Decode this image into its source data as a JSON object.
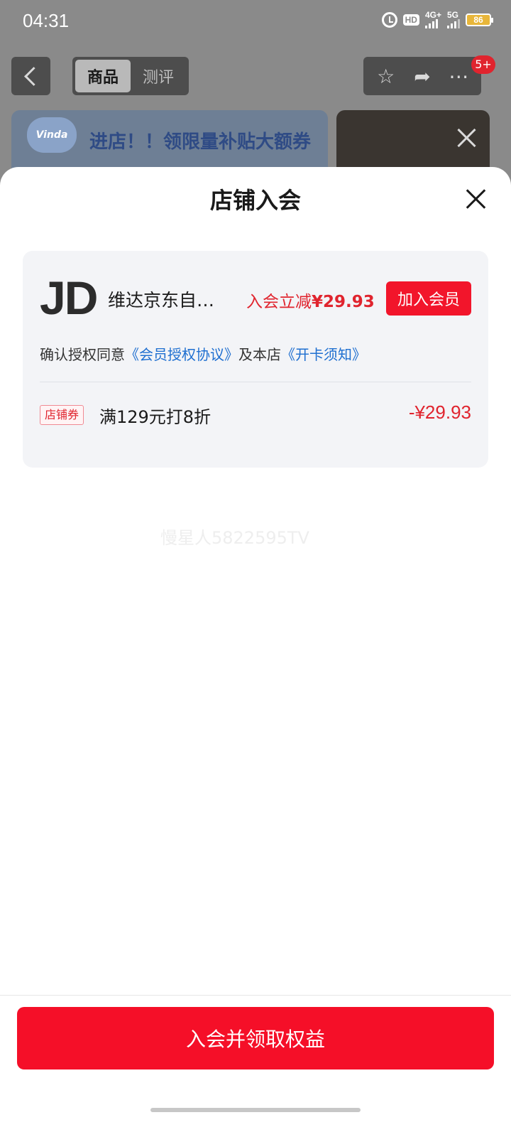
{
  "status_bar": {
    "time": "04:31",
    "hd_label": "HD",
    "network_4g": "4G+",
    "network_5g": "5G",
    "battery": "86",
    "icons": [
      "alarm-icon",
      "hd-icon",
      "signal-4g-icon",
      "signal-5g-icon",
      "battery-icon"
    ]
  },
  "background_page": {
    "tabs": [
      {
        "label": "商品",
        "active": true
      },
      {
        "label": "测评",
        "active": false
      }
    ],
    "actions": [
      "star-icon",
      "share-icon",
      "more-icon"
    ],
    "message_badge": "5+",
    "banner_logo": "Vinda",
    "banner_text": "进店！！领限量补贴大额券"
  },
  "sheet": {
    "title": "店铺入会",
    "close_icon": "close-icon",
    "shop": {
      "logo_text": "JD",
      "name": "维达京东自…",
      "discount_prefix": "入会立减",
      "discount_amount": "¥29.93",
      "join_button": "加入会员"
    },
    "agreement": {
      "prefix": "确认授权同意",
      "link1": "《会员授权协议》",
      "middle": "及本店",
      "link2": "《开卡须知》"
    },
    "coupon": {
      "tag": "店铺券",
      "description": "满129元打8折",
      "amount": "-¥29.93"
    },
    "watermark": "慢星人5822595TV"
  },
  "bottom": {
    "main_button": "入会并领取权益"
  },
  "colors": {
    "accent_red": "#f50f28",
    "link_blue": "#1f6fd0",
    "card_bg": "#f3f4f7"
  }
}
